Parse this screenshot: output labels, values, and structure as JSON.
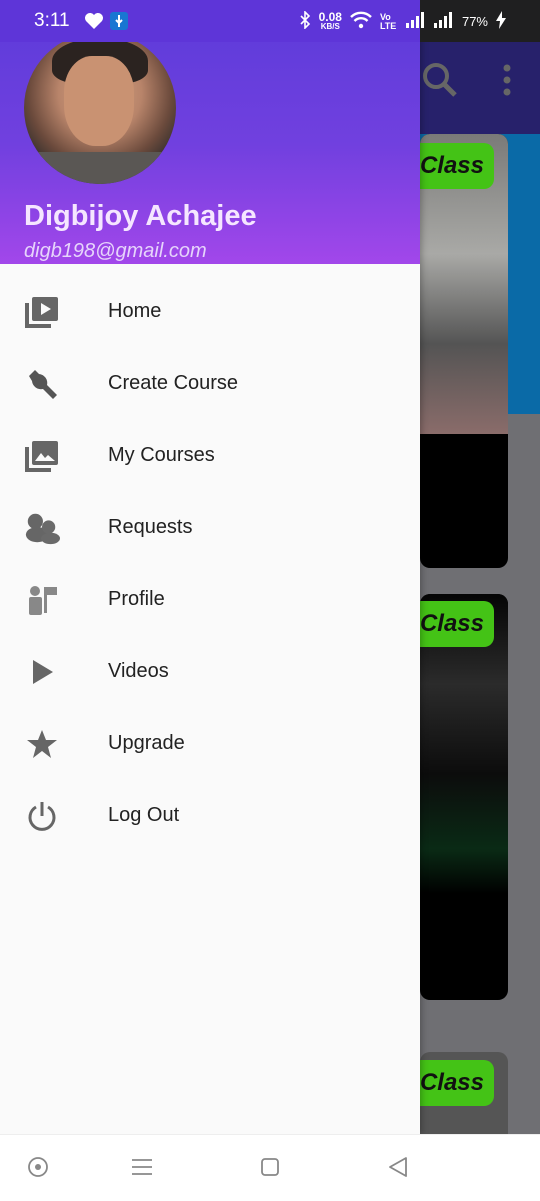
{
  "status_bar": {
    "time": "3:11",
    "net_speed": "0.08",
    "net_unit": "KB/S",
    "volte": "Vo LTE",
    "battery": "77%"
  },
  "drawer": {
    "user_name": "Digbijoy Achajee",
    "user_email": "digb198@gmail.com",
    "items": [
      {
        "label": "Home",
        "icon": "video-library-icon"
      },
      {
        "label": "Create Course",
        "icon": "wrench-icon"
      },
      {
        "label": "My Courses",
        "icon": "photo-library-icon"
      },
      {
        "label": "Requests",
        "icon": "people-icon"
      },
      {
        "label": "Profile",
        "icon": "person-flag-icon"
      },
      {
        "label": "Videos",
        "icon": "play-icon"
      },
      {
        "label": "Upgrade",
        "icon": "star-icon"
      },
      {
        "label": "Log Out",
        "icon": "power-icon"
      }
    ]
  },
  "background": {
    "card_badges": [
      "Class",
      "Class",
      "Class"
    ]
  }
}
